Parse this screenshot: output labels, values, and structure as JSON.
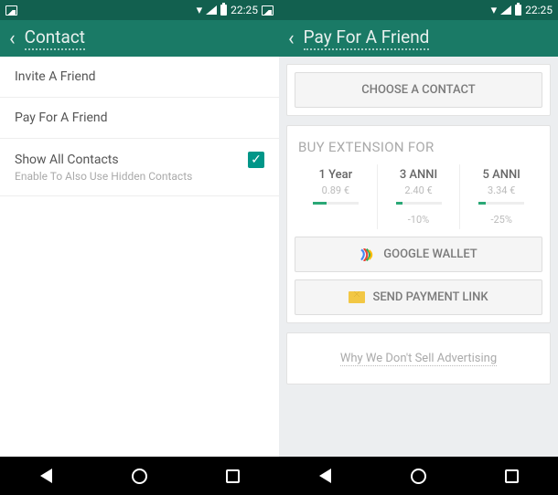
{
  "left": {
    "status": {
      "time": "22:25"
    },
    "app_bar": {
      "title": "Contact"
    },
    "items": {
      "invite": "Invite A Friend",
      "pay": "Pay For A Friend",
      "show_all": "Show All Contacts",
      "show_all_sub": "Enable To Also Use Hidden Contacts"
    }
  },
  "right": {
    "status": {
      "time": "22:25"
    },
    "app_bar": {
      "title": "Pay For A Friend"
    },
    "choose_contact": "CHOOSE A CONTACT",
    "buy_heading": "BUY EXTENSION FOR",
    "plans": [
      {
        "label": "1 Year",
        "price": "0.89 €",
        "fill": 30,
        "discount": ""
      },
      {
        "label": "3 ANNI",
        "price": "2.40 €",
        "fill": 15,
        "discount": "-10%"
      },
      {
        "label": "5 ANNI",
        "price": "3.34 €",
        "fill": 15,
        "discount": "-25%"
      }
    ],
    "google_wallet": "GOOGLE WALLET",
    "send_link": "SEND PAYMENT LINK",
    "ad_link": "Why We Don't Sell Advertising"
  }
}
